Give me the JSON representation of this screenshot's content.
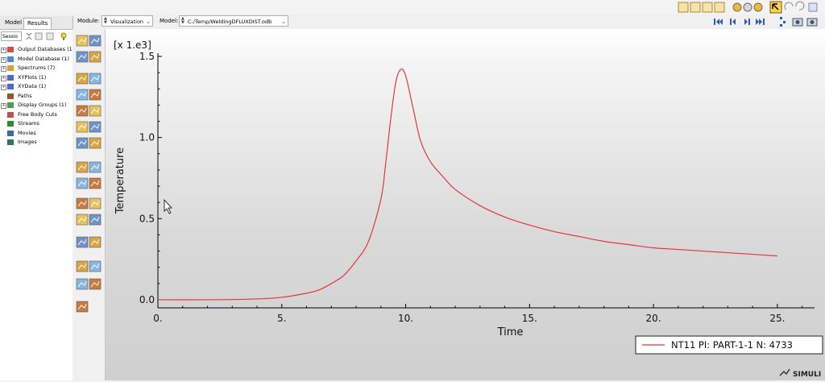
{
  "module_label": "Module:",
  "module_value": "Visualization",
  "model_label": "Model:",
  "model_value": "C:/Temp/WeldingDFLUXDIST.odb",
  "tabs": [
    "Model",
    "Results"
  ],
  "session_combo": "Sessio",
  "tree": [
    {
      "label": "Output Databases (1",
      "icon": "database-icon",
      "expand": true
    },
    {
      "label": "Model Database (1)",
      "icon": "model-database-icon",
      "expand": true
    },
    {
      "label": "Spectrums (7)",
      "icon": "spectrum-icon",
      "expand": true
    },
    {
      "label": "XYPlots (1)",
      "icon": "xyplot-icon",
      "expand": true
    },
    {
      "label": "XYData (1)",
      "icon": "xydata-icon",
      "expand": true
    },
    {
      "label": "Paths",
      "icon": "path-icon",
      "expand": false
    },
    {
      "label": "Display Groups (1)",
      "icon": "display-group-icon",
      "expand": true
    },
    {
      "label": "Free Body Cuts",
      "icon": "free-body-icon",
      "expand": false
    },
    {
      "label": "Streams",
      "icon": "stream-icon",
      "expand": false
    },
    {
      "label": "Movies",
      "icon": "movie-icon",
      "expand": false
    },
    {
      "label": "Images",
      "icon": "image-icon",
      "expand": false
    }
  ],
  "brand_text": "SIMULI",
  "colors": {
    "curve": "#e0383e",
    "plot_bg_top": "#ffffff",
    "plot_bg_bottom": "#cfcfcf",
    "toolbar_bg": "#f0f0f0",
    "nav_blue": "#2a5bb8"
  },
  "chart_data": {
    "type": "line",
    "multiplier_label": "[x 1.e3]",
    "xlabel": "Time",
    "ylabel": "Temperature",
    "xlim": [
      0,
      26.5
    ],
    "ylim": [
      -0.05,
      1.52
    ],
    "xticks": [
      0,
      5,
      10,
      15,
      20,
      25
    ],
    "xtick_labels": [
      "0.",
      "5.",
      "10.",
      "15.",
      "20.",
      "25."
    ],
    "yticks": [
      0,
      0.5,
      1.0,
      1.5
    ],
    "ytick_labels": [
      "0.0",
      "0.5",
      "1.0",
      "1.5"
    ],
    "legend_position": "bottom-right",
    "series": [
      {
        "name": "NT11 PI: PART-1-1 N: 4733",
        "color": "#e0383e",
        "x": [
          0,
          2,
          4,
          5,
          6,
          6.5,
          7,
          7.5,
          8,
          8.5,
          9.0,
          9.2,
          9.4,
          9.6,
          9.8,
          10.0,
          10.3,
          10.6,
          11.0,
          11.5,
          12,
          13,
          14,
          15,
          16,
          17,
          18,
          19,
          20,
          21,
          22,
          23,
          24,
          25
        ],
        "y": [
          0.0,
          0.0,
          0.005,
          0.015,
          0.04,
          0.06,
          0.1,
          0.15,
          0.24,
          0.36,
          0.62,
          0.85,
          1.12,
          1.34,
          1.42,
          1.38,
          1.18,
          0.98,
          0.85,
          0.76,
          0.68,
          0.58,
          0.51,
          0.46,
          0.42,
          0.39,
          0.36,
          0.34,
          0.32,
          0.31,
          0.3,
          0.29,
          0.28,
          0.27
        ]
      }
    ]
  }
}
